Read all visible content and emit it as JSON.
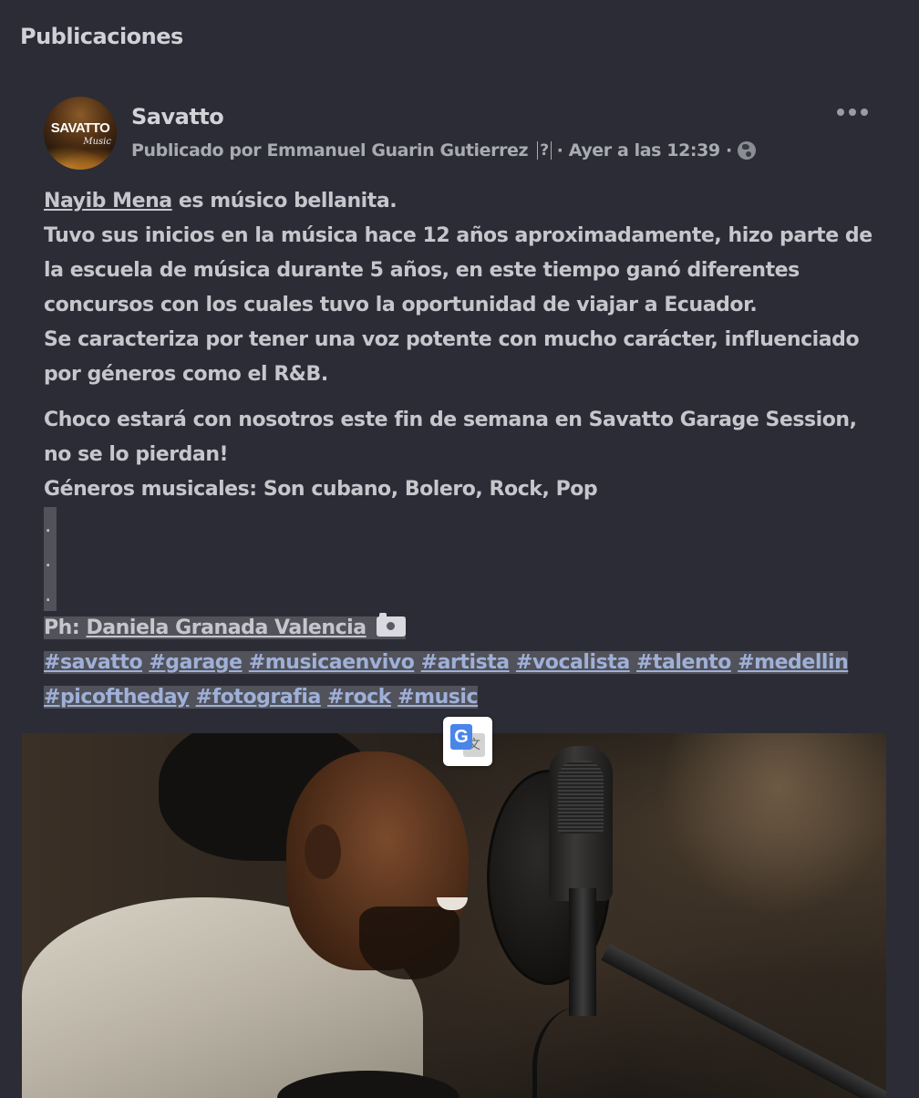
{
  "section": {
    "title": "Publicaciones"
  },
  "post": {
    "avatar": {
      "brand": "SAVATTO",
      "brand_sub": "Music"
    },
    "page_name": "Savatto",
    "meta": {
      "published_by": "Publicado por Emmanuel Guarin Gutierrez",
      "unknown_glyph": "?",
      "time": "· Ayer a las 12:39 ·"
    },
    "body": {
      "mention": "Nayib Mena",
      "line1_rest": " es músico bellanita.",
      "line2": "Tuvo sus inicios en la música hace 12 años aproximadamente, hizo parte de la escuela de música durante 5 años, en este tiempo ganó diferentes concursos con los cuales tuvo la oportunidad de viajar a Ecuador.",
      "line3": "Se caracteriza por tener una voz potente con mucho carácter, influenciado por géneros como el R&B.",
      "para2": "Choco estará con nosotros este fin de semana en Savatto Garage Session, no se lo pierdan!",
      "genres": "Géneros musicales: Son cubano, Bolero, Rock, Pop",
      "dots": [
        ".",
        ".",
        "."
      ],
      "photo_credit_label": "Ph: ",
      "photo_credit_name": "Daniela Granada Valencia",
      "hashtags": [
        "#savatto",
        "#garage",
        "#musicaenvivo",
        "#artista",
        "#vocalista",
        "#talento",
        "#medellin",
        "#picoftheday",
        "#fotografia",
        "#rock",
        "#music"
      ]
    }
  },
  "translate": {
    "g": "G",
    "t": "文"
  },
  "icons": {
    "more": "more-options-icon",
    "globe": "globe-icon",
    "camera": "camera-icon",
    "translate": "google-translate-icon"
  }
}
